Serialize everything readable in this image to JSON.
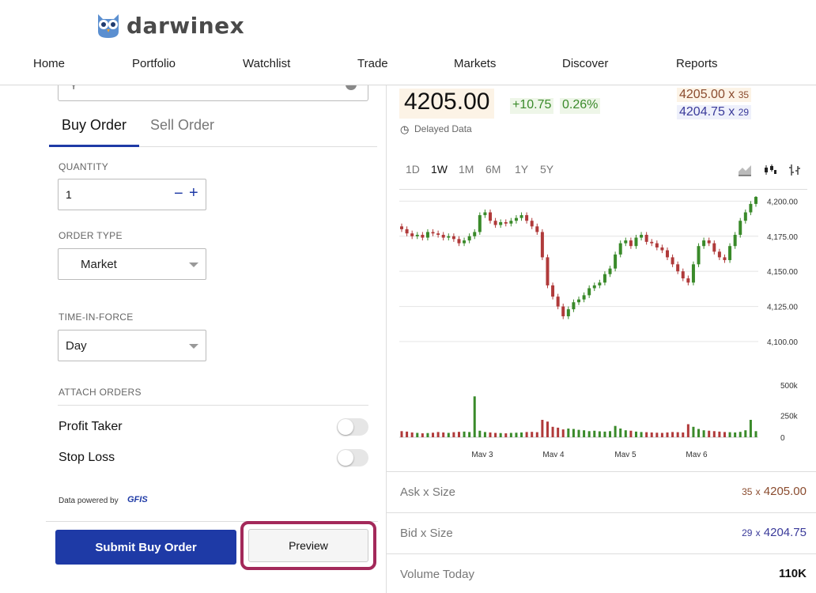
{
  "brand": {
    "name": "darwinex"
  },
  "nav": [
    {
      "label": "Home"
    },
    {
      "label": "Portfolio"
    },
    {
      "label": "Watchlist"
    },
    {
      "label": "Trade"
    },
    {
      "label": "Markets"
    },
    {
      "label": "Discover"
    },
    {
      "label": "Reports"
    }
  ],
  "order": {
    "tabs": [
      {
        "label": "Buy Order",
        "active": true
      },
      {
        "label": "Sell Order",
        "active": false
      }
    ],
    "quantity_label": "QUANTITY",
    "quantity_value": "1",
    "minus": "−",
    "plus": "+",
    "order_type_label": "ORDER TYPE",
    "order_type_value": "Market",
    "tif_label": "TIME-IN-FORCE",
    "tif_value": "Day",
    "attach_label": "ATTACH ORDERS",
    "profit_taker": "Profit Taker",
    "stop_loss": "Stop Loss",
    "powered_by": "Data powered by",
    "provider": "GFIS",
    "submit_label": "Submit Buy Order",
    "preview_label": "Preview"
  },
  "quote": {
    "price": "4205.00",
    "change": "+10.75",
    "change_pct": "0.26%",
    "delayed": "Delayed Data",
    "ask_price": "4205.00",
    "ask_x": "x",
    "ask_size": "35",
    "bid_price": "4204.75",
    "bid_x": "x",
    "bid_size": "29",
    "colors": {
      "up": "#3a8a2a",
      "down": "#b03a3a",
      "accent": "#1e3aa6",
      "highlight": "#a3295a"
    }
  },
  "chart": {
    "ranges": [
      {
        "label": "1D",
        "active": false
      },
      {
        "label": "1W",
        "active": true
      },
      {
        "label": "1M",
        "active": false
      },
      {
        "label": "6M",
        "active": false
      },
      {
        "label": "1Y",
        "active": false
      },
      {
        "label": "5Y",
        "active": false
      }
    ],
    "icons": [
      "area-chart-icon",
      "candlestick-icon",
      "ohlc-icon"
    ]
  },
  "chart_data": {
    "type": "candlestick",
    "x_ticks": [
      "May 3",
      "May 4",
      "May 5",
      "May 6"
    ],
    "y_ticks": [
      "4,200.00",
      "4,175.00",
      "4,150.00",
      "4,125.00",
      "4,100.00"
    ],
    "ylim": [
      4100,
      4200
    ],
    "volume_ticks": [
      "500k",
      "250k",
      "0"
    ],
    "volume_lim": [
      0,
      500000
    ],
    "closes": [
      4180,
      4177,
      4175,
      4176,
      4174,
      4178,
      4177,
      4176,
      4174,
      4175,
      4173,
      4170,
      4172,
      4175,
      4178,
      4190,
      4192,
      4186,
      4183,
      4185,
      4184,
      4186,
      4188,
      4190,
      4186,
      4182,
      4178,
      4160,
      4140,
      4132,
      4125,
      4118,
      4123,
      4128,
      4130,
      4133,
      4138,
      4140,
      4142,
      4148,
      4152,
      4162,
      4170,
      4172,
      4168,
      4174,
      4176,
      4171,
      4170,
      4167,
      4165,
      4160,
      4155,
      4150,
      4145,
      4142,
      4155,
      4168,
      4172,
      4170,
      4164,
      4160,
      4158,
      4168,
      4176,
      4186,
      4192,
      4198,
      4203
    ],
    "volumes": [
      70000,
      65000,
      55000,
      50000,
      45000,
      48000,
      52000,
      60000,
      55000,
      50000,
      58000,
      62000,
      65000,
      60000,
      470000,
      75000,
      60000,
      55000,
      50000,
      48000,
      45000,
      50000,
      52000,
      55000,
      60000,
      62000,
      58000,
      200000,
      180000,
      120000,
      110000,
      90000,
      100000,
      95000,
      85000,
      80000,
      70000,
      75000,
      68000,
      65000,
      70000,
      130000,
      100000,
      80000,
      75000,
      65000,
      60000,
      58000,
      55000,
      52000,
      50000,
      55000,
      60000,
      58000,
      55000,
      150000,
      120000,
      95000,
      80000,
      75000,
      70000,
      65000,
      60000,
      58000,
      55000,
      62000,
      80000,
      200000,
      70000
    ]
  },
  "stats": [
    {
      "label": "Ask x Size",
      "size": "35",
      "x": "x",
      "value": "4205.00",
      "color": "#8a4b2e"
    },
    {
      "label": "Bid x Size",
      "size": "29",
      "x": "x",
      "value": "4204.75",
      "color": "#3a3a9a"
    },
    {
      "label": "Volume Today",
      "size": "",
      "x": "",
      "value": "110K",
      "color": "#111"
    }
  ]
}
